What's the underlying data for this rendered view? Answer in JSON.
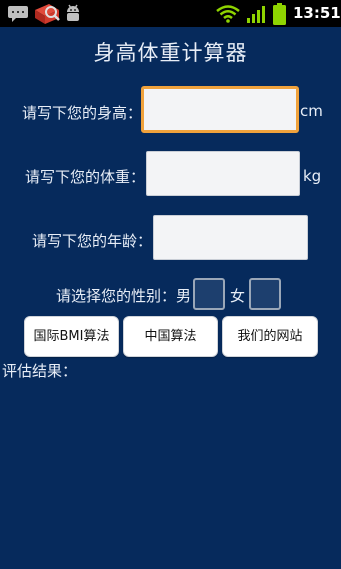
{
  "status_bar": {
    "time": "13:51",
    "icons": [
      "chat-notification-icon",
      "toolbox-notification-icon",
      "android-debug-icon",
      "wifi-icon",
      "cell-signal-icon",
      "battery-icon"
    ]
  },
  "app": {
    "title": "身高体重计算器",
    "height": {
      "label": "请写下您的身高：",
      "value": "",
      "unit": "cm"
    },
    "weight": {
      "label": "请写下您的体重：",
      "value": "",
      "unit": "kg"
    },
    "age": {
      "label": "请写下您的年龄：",
      "value": ""
    },
    "gender": {
      "label": "请选择您的性别：男",
      "male_checked": false,
      "female_label": "女",
      "female_checked": false
    },
    "buttons": {
      "bmi": "国际BMI算法",
      "china": "中国算法",
      "site": "我们的网站"
    },
    "result_label": "评估结果："
  },
  "colors": {
    "background": "#062a5c",
    "status_bar": "#000000",
    "focus_border": "#f0a23c",
    "battery_green": "#8fd400"
  }
}
